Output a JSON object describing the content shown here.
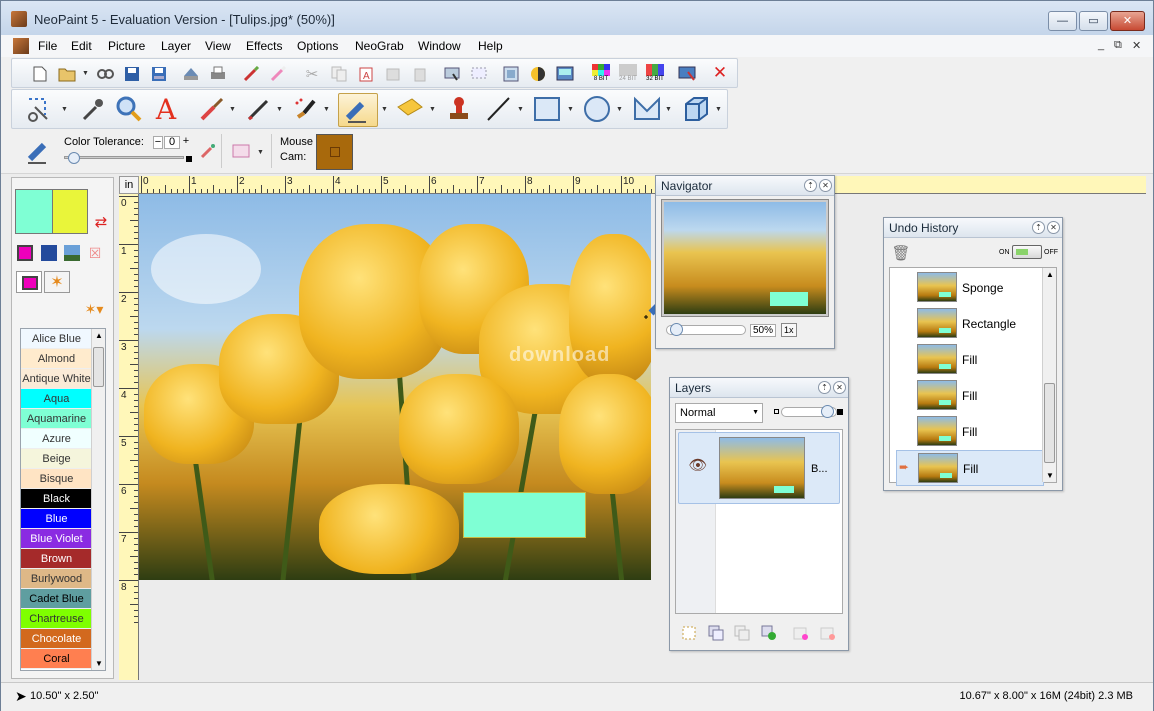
{
  "window": {
    "title": "NeoPaint 5 - Evaluation Version - [Tulips.jpg* (50%)]",
    "minimize_label": "—",
    "maximize_label": "▭",
    "close_label": "✕"
  },
  "menu": {
    "items": [
      "File",
      "Edit",
      "Picture",
      "Layer",
      "View",
      "Effects",
      "Options",
      "NeoGrab",
      "Window",
      "Help"
    ],
    "mdi_controls": [
      "_",
      "⧉",
      "✕"
    ]
  },
  "toolbar_main": {
    "icons": [
      "new-file-icon",
      "open-folder-icon",
      "browse-icon",
      "save-icon",
      "save-as-icon",
      "scan-icon",
      "print-icon",
      "undo-icon",
      "redo-icon",
      "cut-icon",
      "copy-icon",
      "paste-icon",
      "paste-into-icon",
      "delete-icon",
      "crop-icon",
      "select-all-icon",
      "resize-icon",
      "brightness-icon",
      "image-props-icon",
      "8bit-icon",
      "24bit-icon",
      "32bit-icon",
      "screen-capture-icon",
      "close-document-icon"
    ],
    "bit_labels": [
      "8 BIT",
      "24 BIT",
      "32 BIT"
    ]
  },
  "toolbar_tools": {
    "icons": [
      "selection-icon",
      "eyedropper-icon",
      "zoom-icon",
      "text-icon",
      "brush-icon",
      "pen-icon",
      "airbrush-icon",
      "eraser-icon",
      "sponge-icon",
      "stamp-icon",
      "line-icon",
      "rectangle-icon",
      "ellipse-icon",
      "polygon-icon",
      "cube-icon"
    ],
    "text_glyph": "A"
  },
  "options_bar": {
    "color_tolerance_label": "Color Tolerance:",
    "color_tolerance_value": "0",
    "minus": "−",
    "plus": "+",
    "mouse_cam_label_1": "Mouse",
    "mouse_cam_label_2": "Cam:",
    "mouse_cam_color": "#a8690c"
  },
  "left_panel": {
    "primary_color": "#7fffd4",
    "secondary_color": "#e9f53a",
    "swap_icon": "swap-colors-icon",
    "colors": [
      {
        "name": "Alice Blue",
        "hex": "#f0f8ff",
        "fg": "#333"
      },
      {
        "name": "Almond",
        "hex": "#ffebcd",
        "fg": "#333"
      },
      {
        "name": "Antique White",
        "hex": "#faebd7",
        "fg": "#333"
      },
      {
        "name": "Aqua",
        "hex": "#00ffff",
        "fg": "#333"
      },
      {
        "name": "Aquamarine",
        "hex": "#7fffd4",
        "fg": "#333"
      },
      {
        "name": "Azure",
        "hex": "#f0ffff",
        "fg": "#333"
      },
      {
        "name": "Beige",
        "hex": "#f5f5dc",
        "fg": "#333"
      },
      {
        "name": "Bisque",
        "hex": "#ffe4c4",
        "fg": "#333"
      },
      {
        "name": "Black",
        "hex": "#000000",
        "fg": "#fff"
      },
      {
        "name": "Blue",
        "hex": "#0000ff",
        "fg": "#fff"
      },
      {
        "name": "Blue Violet",
        "hex": "#8a2be2",
        "fg": "#fff"
      },
      {
        "name": "Brown",
        "hex": "#a52a2a",
        "fg": "#fff"
      },
      {
        "name": "Burlywood",
        "hex": "#deb887",
        "fg": "#333"
      },
      {
        "name": "Cadet Blue",
        "hex": "#5f9ea0",
        "fg": "#000"
      },
      {
        "name": "Chartreuse",
        "hex": "#7fff00",
        "fg": "#333"
      },
      {
        "name": "Chocolate",
        "hex": "#d2691e",
        "fg": "#fff"
      },
      {
        "name": "Coral",
        "hex": "#ff7f50",
        "fg": "#000"
      }
    ]
  },
  "ruler": {
    "unit": "in",
    "h_numbers": [
      "0",
      "1",
      "2",
      "3",
      "4",
      "5",
      "6",
      "7",
      "8",
      "9",
      "10"
    ],
    "v_numbers": [
      "0",
      "1",
      "2",
      "3",
      "4",
      "5",
      "6",
      "7",
      "8"
    ]
  },
  "canvas": {
    "watermark": "download",
    "rect_color": "#7fffd4"
  },
  "navigator": {
    "title": "Navigator",
    "zoom_value": "50%",
    "one_x_label": "1x"
  },
  "layers": {
    "title": "Layers",
    "blend_mode": "Normal",
    "layer_name": "B..."
  },
  "undo_history": {
    "title": "Undo History",
    "on_label": "ON",
    "off_label": "OFF",
    "items": [
      "Sponge",
      "Rectangle",
      "Fill",
      "Fill",
      "Fill",
      "Fill"
    ]
  },
  "status": {
    "left": "10.50\" x 2.50\"",
    "right": "10.67\" x 8.00\" x 16M (24bit) 2.3 MB"
  }
}
